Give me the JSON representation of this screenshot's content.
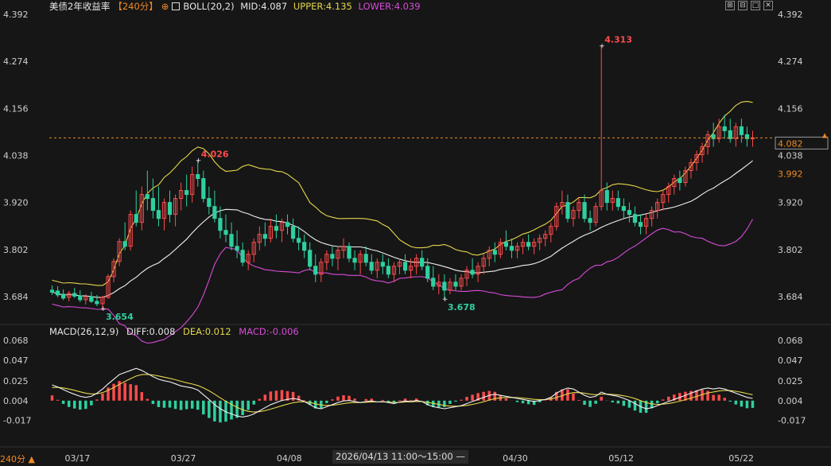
{
  "header": {
    "symbol": "美债2年收益率",
    "period_tag": "【240分】",
    "settings_glyph": "⊕",
    "indicator": "BOLL(20,2)",
    "mid": "MID:4.087",
    "upper": "UPPER:4.135",
    "lower": "LOWER:4.039",
    "toolbar": [
      "⊞",
      "⊟",
      "□",
      "✕"
    ]
  },
  "macd_header": {
    "name": "MACD(26,12,9)",
    "diff": "DIFF:0.008",
    "dea": "DEA:0.012",
    "macd": "MACD:-0.006"
  },
  "footer": {
    "period": "240分 ▲",
    "range_label": "2026/04/13 11:00～15:00 —"
  },
  "colors": {
    "up": "#ff4b4b",
    "down": "#2fd0a0",
    "mid": "#f0f0f0",
    "upper": "#e4d64b",
    "lower": "#d84bd8",
    "dea": "#e4d64b",
    "diff": "#f0f0f0",
    "accent": "#f08a24",
    "grid": "#333333"
  },
  "chart_data": {
    "type": "candlestick",
    "title": "美债2年收益率 240分",
    "price_axis": {
      "ticks": [
        "4.392",
        "4.274",
        "4.156",
        "4.038",
        "3.920",
        "3.802",
        "3.684"
      ],
      "ylim": [
        3.62,
        4.392
      ]
    },
    "macd_axis": {
      "ticks": [
        "0.068",
        "0.047",
        "0.025",
        "0.004",
        "-0.017"
      ],
      "ylim": [
        -0.035,
        0.068
      ]
    },
    "x_ticks": [
      {
        "label": "03/17",
        "frac": 0.04
      },
      {
        "label": "03/27",
        "frac": 0.19
      },
      {
        "label": "04/08",
        "frac": 0.34
      },
      {
        "label": "04/30",
        "frac": 0.66
      },
      {
        "label": "05/12",
        "frac": 0.81
      },
      {
        "label": "05/22",
        "frac": 0.98
      }
    ],
    "annotations": [
      {
        "label": "4.026",
        "idx": 26,
        "at": "high"
      },
      {
        "label": "3.654",
        "idx": 9,
        "at": "low"
      },
      {
        "label": "3.678",
        "idx": 70,
        "at": "low"
      },
      {
        "label": "4.313",
        "idx": 98,
        "at": "high"
      }
    ],
    "current_price": "4.082",
    "last_close_tag": "3.992",
    "candles": [
      {
        "o": 3.7,
        "h": 3.712,
        "l": 3.688,
        "c": 3.695
      },
      {
        "o": 3.698,
        "h": 3.71,
        "l": 3.682,
        "c": 3.688
      },
      {
        "o": 3.69,
        "h": 3.702,
        "l": 3.675,
        "c": 3.68
      },
      {
        "o": 3.682,
        "h": 3.698,
        "l": 3.672,
        "c": 3.692
      },
      {
        "o": 3.692,
        "h": 3.706,
        "l": 3.68,
        "c": 3.685
      },
      {
        "o": 3.686,
        "h": 3.7,
        "l": 3.67,
        "c": 3.676
      },
      {
        "o": 3.676,
        "h": 3.69,
        "l": 3.664,
        "c": 3.684
      },
      {
        "o": 3.684,
        "h": 3.696,
        "l": 3.668,
        "c": 3.672
      },
      {
        "o": 3.672,
        "h": 3.688,
        "l": 3.66,
        "c": 3.666
      },
      {
        "o": 3.666,
        "h": 3.686,
        "l": 3.654,
        "c": 3.682
      },
      {
        "o": 3.682,
        "h": 3.74,
        "l": 3.678,
        "c": 3.734
      },
      {
        "o": 3.734,
        "h": 3.78,
        "l": 3.72,
        "c": 3.772
      },
      {
        "o": 3.772,
        "h": 3.83,
        "l": 3.76,
        "c": 3.822
      },
      {
        "o": 3.822,
        "h": 3.87,
        "l": 3.8,
        "c": 3.81
      },
      {
        "o": 3.81,
        "h": 3.9,
        "l": 3.8,
        "c": 3.89
      },
      {
        "o": 3.89,
        "h": 3.95,
        "l": 3.86,
        "c": 3.87
      },
      {
        "o": 3.87,
        "h": 3.96,
        "l": 3.85,
        "c": 3.94
      },
      {
        "o": 3.94,
        "h": 4.0,
        "l": 3.9,
        "c": 3.93
      },
      {
        "o": 3.93,
        "h": 3.98,
        "l": 3.88,
        "c": 3.9
      },
      {
        "o": 3.9,
        "h": 3.96,
        "l": 3.86,
        "c": 3.88
      },
      {
        "o": 3.88,
        "h": 3.93,
        "l": 3.85,
        "c": 3.92
      },
      {
        "o": 3.92,
        "h": 3.95,
        "l": 3.87,
        "c": 3.89
      },
      {
        "o": 3.89,
        "h": 3.94,
        "l": 3.86,
        "c": 3.93
      },
      {
        "o": 3.93,
        "h": 3.97,
        "l": 3.9,
        "c": 3.95
      },
      {
        "o": 3.95,
        "h": 3.99,
        "l": 3.91,
        "c": 3.94
      },
      {
        "o": 3.94,
        "h": 4.01,
        "l": 3.92,
        "c": 3.99
      },
      {
        "o": 3.99,
        "h": 4.026,
        "l": 3.96,
        "c": 3.98
      },
      {
        "o": 3.98,
        "h": 4.0,
        "l": 3.92,
        "c": 3.93
      },
      {
        "o": 3.93,
        "h": 3.96,
        "l": 3.89,
        "c": 3.91
      },
      {
        "o": 3.91,
        "h": 3.95,
        "l": 3.87,
        "c": 3.88
      },
      {
        "o": 3.88,
        "h": 3.91,
        "l": 3.83,
        "c": 3.85
      },
      {
        "o": 3.85,
        "h": 3.89,
        "l": 3.82,
        "c": 3.84
      },
      {
        "o": 3.84,
        "h": 3.87,
        "l": 3.8,
        "c": 3.81
      },
      {
        "o": 3.81,
        "h": 3.85,
        "l": 3.78,
        "c": 3.8
      },
      {
        "o": 3.8,
        "h": 3.82,
        "l": 3.76,
        "c": 3.77
      },
      {
        "o": 3.77,
        "h": 3.8,
        "l": 3.75,
        "c": 3.79
      },
      {
        "o": 3.79,
        "h": 3.83,
        "l": 3.77,
        "c": 3.82
      },
      {
        "o": 3.82,
        "h": 3.86,
        "l": 3.8,
        "c": 3.84
      },
      {
        "o": 3.84,
        "h": 3.87,
        "l": 3.81,
        "c": 3.83
      },
      {
        "o": 3.83,
        "h": 3.88,
        "l": 3.82,
        "c": 3.86
      },
      {
        "o": 3.86,
        "h": 3.89,
        "l": 3.83,
        "c": 3.85
      },
      {
        "o": 3.85,
        "h": 3.88,
        "l": 3.82,
        "c": 3.87
      },
      {
        "o": 3.87,
        "h": 3.89,
        "l": 3.84,
        "c": 3.86
      },
      {
        "o": 3.86,
        "h": 3.88,
        "l": 3.82,
        "c": 3.83
      },
      {
        "o": 3.83,
        "h": 3.86,
        "l": 3.8,
        "c": 3.82
      },
      {
        "o": 3.82,
        "h": 3.84,
        "l": 3.78,
        "c": 3.8
      },
      {
        "o": 3.8,
        "h": 3.82,
        "l": 3.75,
        "c": 3.76
      },
      {
        "o": 3.76,
        "h": 3.79,
        "l": 3.72,
        "c": 3.74
      },
      {
        "o": 3.74,
        "h": 3.78,
        "l": 3.72,
        "c": 3.77
      },
      {
        "o": 3.77,
        "h": 3.8,
        "l": 3.75,
        "c": 3.79
      },
      {
        "o": 3.79,
        "h": 3.81,
        "l": 3.76,
        "c": 3.78
      },
      {
        "o": 3.78,
        "h": 3.81,
        "l": 3.75,
        "c": 3.8
      },
      {
        "o": 3.8,
        "h": 3.83,
        "l": 3.78,
        "c": 3.81
      },
      {
        "o": 3.81,
        "h": 3.82,
        "l": 3.77,
        "c": 3.78
      },
      {
        "o": 3.78,
        "h": 3.8,
        "l": 3.75,
        "c": 3.77
      },
      {
        "o": 3.77,
        "h": 3.8,
        "l": 3.74,
        "c": 3.79
      },
      {
        "o": 3.79,
        "h": 3.81,
        "l": 3.76,
        "c": 3.77
      },
      {
        "o": 3.77,
        "h": 3.79,
        "l": 3.74,
        "c": 3.75
      },
      {
        "o": 3.75,
        "h": 3.78,
        "l": 3.73,
        "c": 3.77
      },
      {
        "o": 3.77,
        "h": 3.79,
        "l": 3.74,
        "c": 3.76
      },
      {
        "o": 3.76,
        "h": 3.78,
        "l": 3.73,
        "c": 3.74
      },
      {
        "o": 3.74,
        "h": 3.77,
        "l": 3.72,
        "c": 3.76
      },
      {
        "o": 3.76,
        "h": 3.78,
        "l": 3.74,
        "c": 3.77
      },
      {
        "o": 3.77,
        "h": 3.79,
        "l": 3.74,
        "c": 3.75
      },
      {
        "o": 3.75,
        "h": 3.78,
        "l": 3.73,
        "c": 3.76
      },
      {
        "o": 3.76,
        "h": 3.79,
        "l": 3.74,
        "c": 3.78
      },
      {
        "o": 3.78,
        "h": 3.8,
        "l": 3.75,
        "c": 3.76
      },
      {
        "o": 3.76,
        "h": 3.78,
        "l": 3.72,
        "c": 3.73
      },
      {
        "o": 3.73,
        "h": 3.76,
        "l": 3.7,
        "c": 3.71
      },
      {
        "o": 3.71,
        "h": 3.74,
        "l": 3.69,
        "c": 3.72
      },
      {
        "o": 3.72,
        "h": 3.74,
        "l": 3.678,
        "c": 3.7
      },
      {
        "o": 3.7,
        "h": 3.73,
        "l": 3.69,
        "c": 3.72
      },
      {
        "o": 3.72,
        "h": 3.74,
        "l": 3.7,
        "c": 3.71
      },
      {
        "o": 3.71,
        "h": 3.74,
        "l": 3.7,
        "c": 3.73
      },
      {
        "o": 3.73,
        "h": 3.76,
        "l": 3.71,
        "c": 3.75
      },
      {
        "o": 3.75,
        "h": 3.78,
        "l": 3.73,
        "c": 3.74
      },
      {
        "o": 3.74,
        "h": 3.77,
        "l": 3.72,
        "c": 3.76
      },
      {
        "o": 3.76,
        "h": 3.79,
        "l": 3.74,
        "c": 3.78
      },
      {
        "o": 3.78,
        "h": 3.81,
        "l": 3.76,
        "c": 3.8
      },
      {
        "o": 3.8,
        "h": 3.82,
        "l": 3.77,
        "c": 3.79
      },
      {
        "o": 3.79,
        "h": 3.83,
        "l": 3.78,
        "c": 3.82
      },
      {
        "o": 3.82,
        "h": 3.85,
        "l": 3.8,
        "c": 3.81
      },
      {
        "o": 3.81,
        "h": 3.83,
        "l": 3.78,
        "c": 3.8
      },
      {
        "o": 3.8,
        "h": 3.82,
        "l": 3.78,
        "c": 3.81
      },
      {
        "o": 3.81,
        "h": 3.83,
        "l": 3.79,
        "c": 3.82
      },
      {
        "o": 3.82,
        "h": 3.84,
        "l": 3.8,
        "c": 3.81
      },
      {
        "o": 3.81,
        "h": 3.83,
        "l": 3.79,
        "c": 3.82
      },
      {
        "o": 3.82,
        "h": 3.84,
        "l": 3.8,
        "c": 3.83
      },
      {
        "o": 3.83,
        "h": 3.85,
        "l": 3.81,
        "c": 3.84
      },
      {
        "o": 3.84,
        "h": 3.87,
        "l": 3.82,
        "c": 3.86
      },
      {
        "o": 3.86,
        "h": 3.92,
        "l": 3.85,
        "c": 3.91
      },
      {
        "o": 3.91,
        "h": 3.95,
        "l": 3.89,
        "c": 3.92
      },
      {
        "o": 3.92,
        "h": 3.94,
        "l": 3.87,
        "c": 3.88
      },
      {
        "o": 3.88,
        "h": 3.91,
        "l": 3.86,
        "c": 3.9
      },
      {
        "o": 3.9,
        "h": 3.93,
        "l": 3.88,
        "c": 3.92
      },
      {
        "o": 3.92,
        "h": 3.94,
        "l": 3.87,
        "c": 3.88
      },
      {
        "o": 3.88,
        "h": 3.9,
        "l": 3.85,
        "c": 3.87
      },
      {
        "o": 3.87,
        "h": 3.92,
        "l": 3.86,
        "c": 3.91
      },
      {
        "o": 3.91,
        "h": 4.313,
        "l": 3.9,
        "c": 3.95
      },
      {
        "o": 3.95,
        "h": 3.97,
        "l": 3.9,
        "c": 3.92
      },
      {
        "o": 3.92,
        "h": 3.95,
        "l": 3.9,
        "c": 3.93
      },
      {
        "o": 3.93,
        "h": 3.95,
        "l": 3.9,
        "c": 3.91
      },
      {
        "o": 3.91,
        "h": 3.93,
        "l": 3.88,
        "c": 3.9
      },
      {
        "o": 3.9,
        "h": 3.92,
        "l": 3.87,
        "c": 3.89
      },
      {
        "o": 3.89,
        "h": 3.91,
        "l": 3.86,
        "c": 3.87
      },
      {
        "o": 3.87,
        "h": 3.89,
        "l": 3.84,
        "c": 3.86
      },
      {
        "o": 3.86,
        "h": 3.89,
        "l": 3.84,
        "c": 3.88
      },
      {
        "o": 3.88,
        "h": 3.91,
        "l": 3.86,
        "c": 3.9
      },
      {
        "o": 3.9,
        "h": 3.93,
        "l": 3.88,
        "c": 3.92
      },
      {
        "o": 3.92,
        "h": 3.95,
        "l": 3.9,
        "c": 3.94
      },
      {
        "o": 3.94,
        "h": 3.97,
        "l": 3.92,
        "c": 3.96
      },
      {
        "o": 3.96,
        "h": 3.99,
        "l": 3.94,
        "c": 3.98
      },
      {
        "o": 3.98,
        "h": 4.0,
        "l": 3.95,
        "c": 3.97
      },
      {
        "o": 3.97,
        "h": 4.01,
        "l": 3.96,
        "c": 4.0
      },
      {
        "o": 4.0,
        "h": 4.03,
        "l": 3.98,
        "c": 4.02
      },
      {
        "o": 4.02,
        "h": 4.05,
        "l": 4.0,
        "c": 4.04
      },
      {
        "o": 4.04,
        "h": 4.07,
        "l": 4.02,
        "c": 4.06
      },
      {
        "o": 4.06,
        "h": 4.1,
        "l": 4.04,
        "c": 4.09
      },
      {
        "o": 4.09,
        "h": 4.12,
        "l": 4.06,
        "c": 4.08
      },
      {
        "o": 4.08,
        "h": 4.13,
        "l": 4.07,
        "c": 4.11
      },
      {
        "o": 4.11,
        "h": 4.14,
        "l": 4.08,
        "c": 4.1
      },
      {
        "o": 4.1,
        "h": 4.13,
        "l": 4.07,
        "c": 4.08
      },
      {
        "o": 4.08,
        "h": 4.12,
        "l": 4.06,
        "c": 4.11
      },
      {
        "o": 4.11,
        "h": 4.13,
        "l": 4.07,
        "c": 4.09
      },
      {
        "o": 4.09,
        "h": 4.11,
        "l": 4.06,
        "c": 4.08
      },
      {
        "o": 4.08,
        "h": 4.1,
        "l": 4.06,
        "c": 4.082
      }
    ],
    "macd": [
      0.034,
      0.03,
      0.025,
      0.02,
      0.016,
      0.012,
      0.01,
      0.012,
      0.018,
      0.026,
      0.036,
      0.045,
      0.054,
      0.058,
      0.062,
      0.066,
      0.062,
      0.056,
      0.05,
      0.045,
      0.042,
      0.04,
      0.036,
      0.032,
      0.03,
      0.028,
      0.024,
      0.015,
      0.006,
      -0.004,
      -0.012,
      -0.018,
      -0.022,
      -0.026,
      -0.028,
      -0.026,
      -0.022,
      -0.016,
      -0.01,
      -0.004,
      0.0,
      0.004,
      0.006,
      0.008,
      0.006,
      0.002,
      -0.004,
      -0.01,
      -0.012,
      -0.008,
      -0.004,
      0.0,
      0.003,
      0.004,
      0.002,
      0.0,
      0.002,
      0.003,
      0.001,
      0.002,
      0.0,
      -0.002,
      0.001,
      0.003,
      0.002,
      0.004,
      0.002,
      -0.004,
      -0.008,
      -0.01,
      -0.012,
      -0.01,
      -0.008,
      -0.006,
      -0.002,
      0.002,
      0.006,
      0.01,
      0.014,
      0.016,
      0.014,
      0.012,
      0.01,
      0.008,
      0.006,
      0.004,
      0.002,
      0.004,
      0.006,
      0.01,
      0.018,
      0.024,
      0.028,
      0.026,
      0.02,
      0.014,
      0.01,
      0.012,
      0.02,
      0.016,
      0.014,
      0.012,
      0.008,
      0.004,
      -0.002,
      -0.008,
      -0.012,
      -0.01,
      -0.006,
      -0.002,
      0.002,
      0.006,
      0.01,
      0.014,
      0.018,
      0.022,
      0.026,
      0.028,
      0.026,
      0.028,
      0.026,
      0.022,
      0.018,
      0.014,
      0.01,
      0.008
    ]
  }
}
